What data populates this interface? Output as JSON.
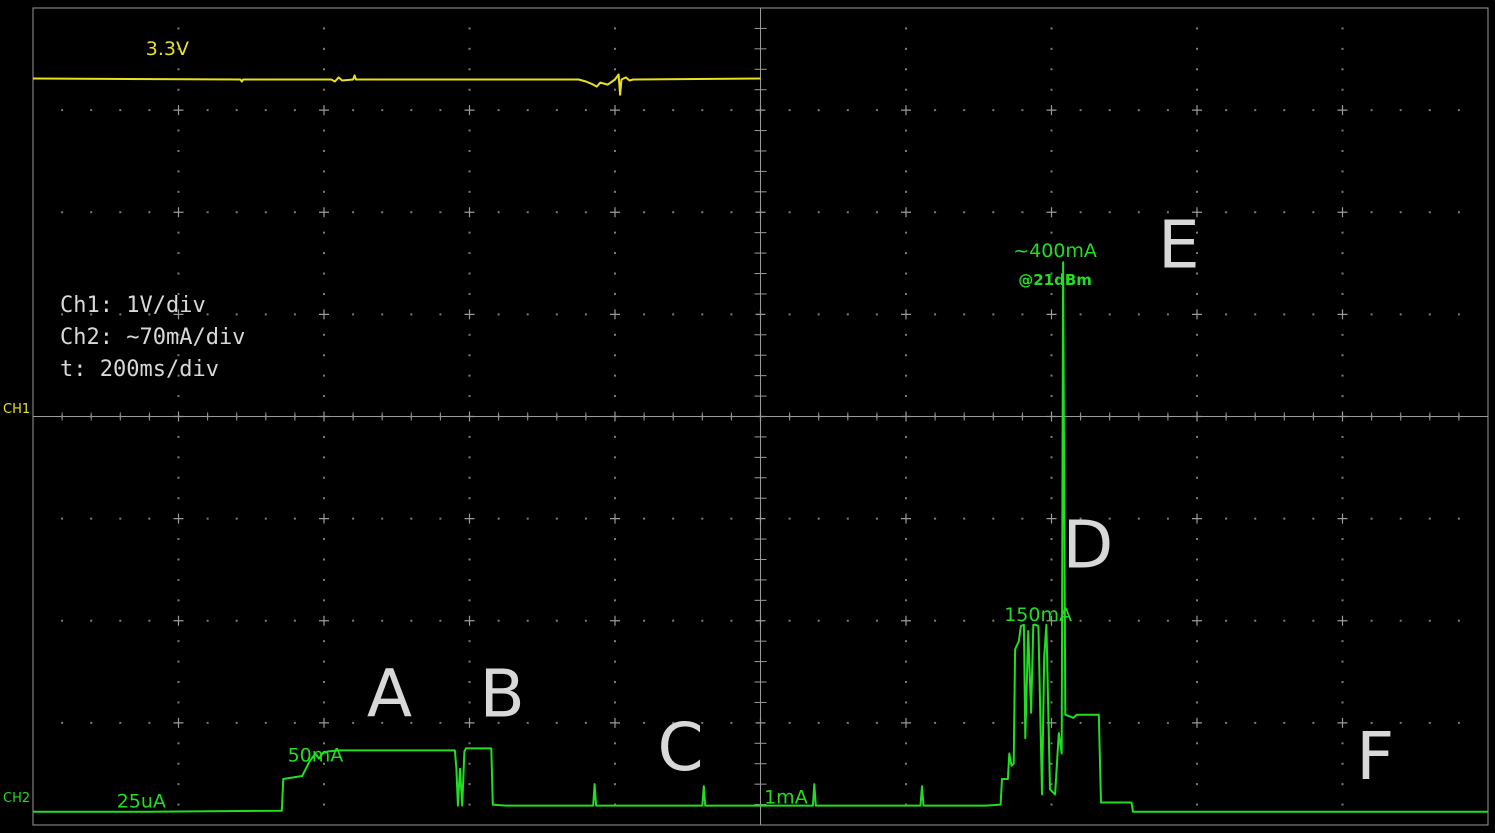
{
  "chart_data": {
    "type": "line",
    "title": "",
    "xlabel": "",
    "ylabel": "",
    "grid": true,
    "x_divisions": 10,
    "y_divisions": 8,
    "settings": {
      "ch1": "Ch1: 1V/div",
      "ch2": "Ch2: ~70mA/div",
      "time": "t: 200ms/div"
    },
    "channel_markers": {
      "ch1": "CH1",
      "ch2": "CH2"
    },
    "colors": {
      "ch1": "#e8e020",
      "ch2": "#22dd22",
      "grid": "#9a9a9a",
      "label": "#d8d8d8"
    },
    "series": [
      {
        "name": "CH1",
        "unit_per_div": "1V",
        "ref_div": 4.0,
        "points": [
          [
            0.0,
            7.31
          ],
          [
            2.85,
            7.3
          ],
          [
            2.87,
            7.28
          ],
          [
            2.89,
            7.3
          ],
          [
            4.1,
            7.3
          ],
          [
            4.15,
            7.28
          ],
          [
            4.2,
            7.32
          ],
          [
            4.25,
            7.29
          ],
          [
            4.4,
            7.3
          ],
          [
            4.42,
            7.34
          ],
          [
            4.44,
            7.3
          ],
          [
            7.5,
            7.3
          ],
          [
            7.6,
            7.28
          ],
          [
            7.7,
            7.25
          ],
          [
            7.75,
            7.23
          ],
          [
            7.8,
            7.27
          ],
          [
            7.9,
            7.25
          ],
          [
            8.0,
            7.3
          ],
          [
            8.05,
            7.35
          ],
          [
            8.07,
            7.15
          ],
          [
            8.09,
            7.3
          ],
          [
            8.15,
            7.32
          ],
          [
            8.2,
            7.29
          ],
          [
            8.25,
            7.3
          ],
          [
            10.0,
            7.31
          ]
        ]
      },
      {
        "name": "CH2",
        "unit_per_div": "~70mA",
        "ref_div": 0.1,
        "points": [
          [
            0.0,
            0.13
          ],
          [
            1.6,
            0.13
          ],
          [
            3.42,
            0.14
          ],
          [
            3.44,
            0.45
          ],
          [
            3.7,
            0.48
          ],
          [
            3.8,
            0.62
          ],
          [
            3.88,
            0.7
          ],
          [
            3.93,
            0.65
          ],
          [
            3.98,
            0.7
          ],
          [
            4.05,
            0.72
          ],
          [
            4.2,
            0.73
          ],
          [
            5.8,
            0.73
          ],
          [
            5.82,
            0.55
          ],
          [
            5.84,
            0.19
          ],
          [
            5.87,
            0.55
          ],
          [
            5.9,
            0.19
          ],
          [
            5.93,
            0.72
          ],
          [
            5.95,
            0.75
          ],
          [
            6.3,
            0.75
          ],
          [
            6.32,
            0.2
          ],
          [
            6.5,
            0.19
          ],
          [
            7.7,
            0.19
          ],
          [
            7.72,
            0.4
          ],
          [
            7.74,
            0.19
          ],
          [
            9.2,
            0.19
          ],
          [
            9.22,
            0.38
          ],
          [
            9.24,
            0.19
          ],
          [
            10.72,
            0.19
          ],
          [
            10.74,
            0.4
          ],
          [
            10.76,
            0.19
          ],
          [
            12.2,
            0.19
          ],
          [
            12.22,
            0.38
          ],
          [
            12.24,
            0.19
          ],
          [
            13.1,
            0.19
          ],
          [
            13.3,
            0.2
          ],
          [
            13.32,
            0.45
          ],
          [
            13.4,
            0.45
          ],
          [
            13.42,
            0.7
          ],
          [
            13.45,
            0.58
          ],
          [
            13.48,
            0.6
          ],
          [
            13.5,
            1.72
          ],
          [
            13.55,
            1.8
          ],
          [
            13.58,
            1.95
          ],
          [
            13.62,
            1.96
          ],
          [
            13.64,
            0.85
          ],
          [
            13.68,
            1.9
          ],
          [
            13.72,
            1.1
          ],
          [
            13.75,
            1.96
          ],
          [
            13.78,
            1.96
          ],
          [
            13.82,
            1.95
          ],
          [
            13.87,
            0.3
          ],
          [
            13.9,
            1.65
          ],
          [
            13.93,
            1.96
          ],
          [
            13.98,
            0.35
          ],
          [
            14.05,
            0.3
          ],
          [
            14.1,
            0.9
          ],
          [
            14.14,
            0.7
          ],
          [
            14.16,
            5.51
          ],
          [
            14.19,
            1.08
          ],
          [
            14.3,
            1.05
          ],
          [
            14.35,
            1.08
          ],
          [
            14.65,
            1.08
          ],
          [
            14.68,
            0.22
          ],
          [
            15.1,
            0.22
          ],
          [
            15.12,
            0.13
          ],
          [
            20.0,
            0.13
          ]
        ]
      }
    ],
    "trace_labels": [
      {
        "text": "3.3V",
        "x": 1.55,
        "y": 7.54,
        "series": "CH1"
      },
      {
        "text": "25uA",
        "x": 1.15,
        "y": 0.17,
        "series": "CH2"
      },
      {
        "text": "50mA",
        "x": 3.5,
        "y": 0.62,
        "series": "CH2"
      },
      {
        "text": "1mA",
        "x": 10.05,
        "y": 0.21,
        "series": "CH2"
      },
      {
        "text": "150mA",
        "x": 13.35,
        "y": 2.0,
        "series": "CH2"
      },
      {
        "text": "~400mA",
        "x": 14.05,
        "y": 5.56,
        "series": "CH2"
      },
      {
        "text": "@21dBm",
        "x": 14.05,
        "y": 5.29,
        "series": "CH2"
      }
    ],
    "phase_labels": [
      {
        "text": "A",
        "x": 4.9,
        "y": 1.06
      },
      {
        "text": "B",
        "x": 6.45,
        "y": 1.06
      },
      {
        "text": "C",
        "x": 8.9,
        "y": 0.54
      },
      {
        "text": "D",
        "x": 14.5,
        "y": 2.52
      },
      {
        "text": "E",
        "x": 15.75,
        "y": 5.46
      },
      {
        "text": "F",
        "x": 18.45,
        "y": 0.45
      }
    ]
  }
}
